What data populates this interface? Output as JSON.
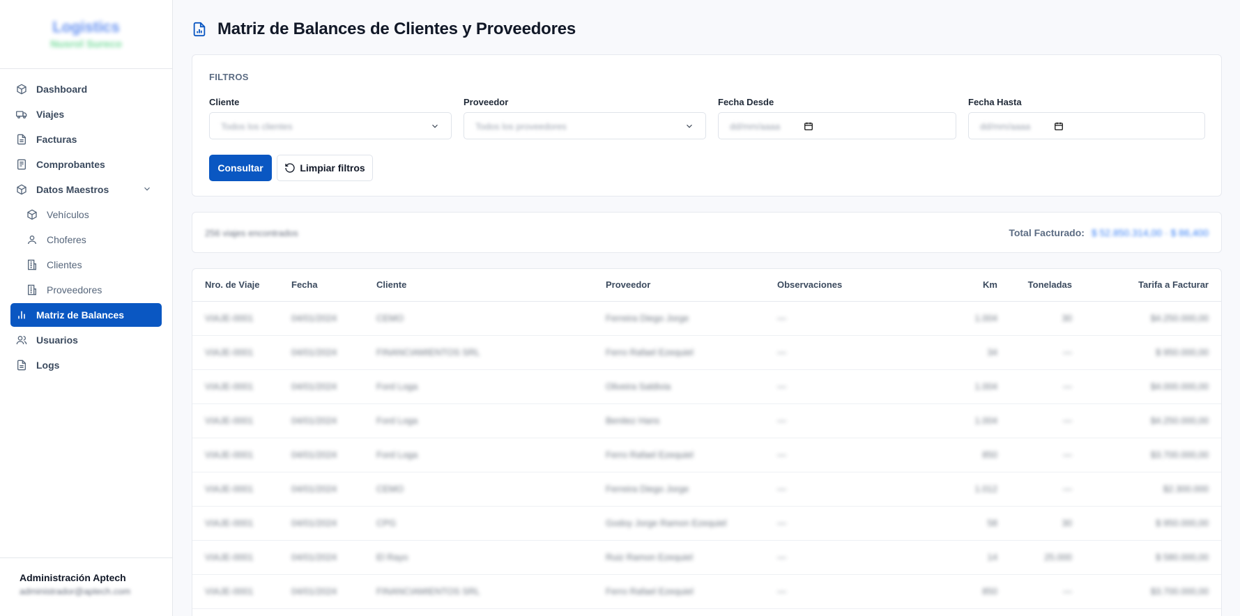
{
  "app": {
    "logo_title": "Logistics",
    "logo_subtitle": "Nusrol Sureco"
  },
  "sidebar": {
    "items": [
      {
        "label": "Dashboard",
        "icon": "box-icon"
      },
      {
        "label": "Viajes",
        "icon": "truck-icon"
      },
      {
        "label": "Facturas",
        "icon": "document-icon"
      },
      {
        "label": "Comprobantes",
        "icon": "receipt-icon"
      },
      {
        "label": "Datos Maestros",
        "icon": "box-icon",
        "expanded": true
      },
      {
        "label": "Vehículos",
        "icon": "box-icon",
        "sub": true
      },
      {
        "label": "Choferes",
        "icon": "user-icon",
        "sub": true
      },
      {
        "label": "Clientes",
        "icon": "building-icon",
        "sub": true
      },
      {
        "label": "Proveedores",
        "icon": "building-icon",
        "sub": true
      },
      {
        "label": "Matriz de Balances",
        "icon": "bar-chart-icon",
        "active": true
      },
      {
        "label": "Usuarios",
        "icon": "users-icon"
      },
      {
        "label": "Logs",
        "icon": "document-icon"
      }
    ],
    "user": {
      "name": "Administración Aptech",
      "email": "administrador@aptech.com"
    }
  },
  "page": {
    "title": "Matriz de Balances de Clientes y Proveedores"
  },
  "filters": {
    "title": "FILTROS",
    "cliente": {
      "label": "Cliente",
      "placeholder": "Todos los clientes"
    },
    "proveedor": {
      "label": "Proveedor",
      "placeholder": "Todos los proveedores"
    },
    "fecha_desde": {
      "label": "Fecha Desde",
      "placeholder": "dd/mm/aaaa"
    },
    "fecha_hasta": {
      "label": "Fecha Hasta",
      "placeholder": "dd/mm/aaaa"
    },
    "consultar_label": "Consultar",
    "limpiar_label": "Limpiar filtros"
  },
  "summary": {
    "count_text": "256 viajes encontrados",
    "total_label": "Total Facturado:",
    "total_value": "$ 52.850.314,00 · $ 86,400"
  },
  "table": {
    "columns": [
      "Nro. de Viaje",
      "Fecha",
      "Cliente",
      "Proveedor",
      "Observaciones",
      "Km",
      "Toneladas",
      "Tarifa a Facturar"
    ],
    "rows": [
      [
        "VIAJE-0001",
        "04/01/2024",
        "CEMO",
        "Ferreira Diego Jorge",
        "—",
        "1.004",
        "30",
        "$4.250.000,00"
      ],
      [
        "VIAJE-0001",
        "04/01/2024",
        "FINANCIAMIENTOS SRL",
        "Ferro Rafael Ezequiel",
        "—",
        "34",
        "—",
        "$ 950.000,00"
      ],
      [
        "VIAJE-0001",
        "04/01/2024",
        "Ford Loga",
        "Oliveira Saldivia",
        "—",
        "1.004",
        "—",
        "$4.000.000,00"
      ],
      [
        "VIAJE-0001",
        "04/01/2024",
        "Ford Loga",
        "Benitez Hans",
        "—",
        "1.004",
        "—",
        "$4.250.000,00"
      ],
      [
        "VIAJE-0001",
        "04/01/2024",
        "Ford Loga",
        "Ferro Rafael Ezequiel",
        "—",
        "850",
        "—",
        "$3.700.000,00"
      ],
      [
        "VIAJE-0001",
        "04/01/2024",
        "CEMO",
        "Ferreira Diego Jorge",
        "—",
        "1.012",
        "—",
        "$2.300.000"
      ],
      [
        "VIAJE-0001",
        "04/01/2024",
        "CPG",
        "Godoy Jorge Ramon Ezequiel",
        "—",
        "58",
        "30",
        "$ 950.000,00"
      ],
      [
        "VIAJE-0001",
        "04/01/2024",
        "El Rayo",
        "Ruiz Ramon Ezequiel",
        "—",
        "14",
        "25.000",
        "$ 580.000,00"
      ],
      [
        "VIAJE-0001",
        "04/01/2024",
        "FINANCIAMIENTOS SRL",
        "Ferro Rafael Ezequiel",
        "—",
        "850",
        "—",
        "$3.700.000,00"
      ]
    ]
  },
  "colors": {
    "accent": "#0a57c2",
    "border": "#e6e9ef",
    "background": "#f8f9fc"
  }
}
